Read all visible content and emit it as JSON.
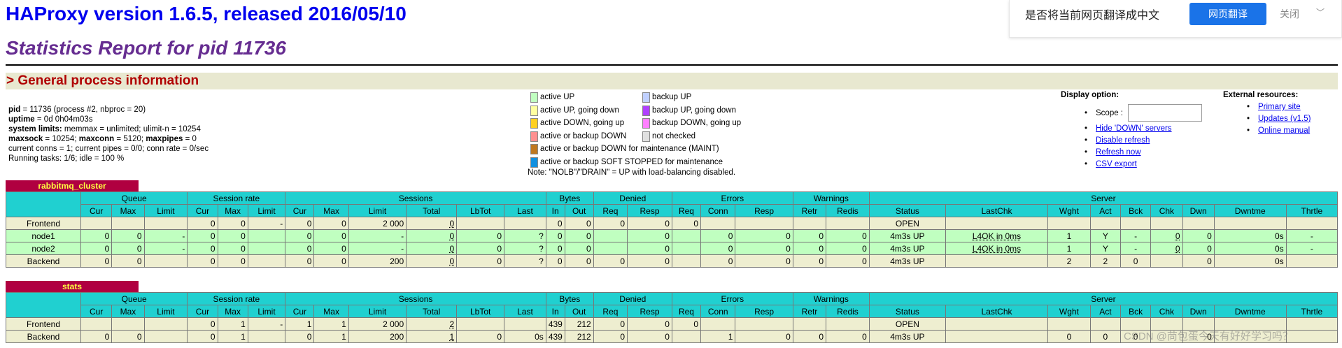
{
  "header": {
    "title": "HAProxy version 1.6.5, released 2016/05/10",
    "subtitle": "Statistics Report for pid 11736"
  },
  "translate_bar": {
    "question": "是否将当前网页翻译成中文",
    "translate_button": "网页翻译",
    "close": "关闭",
    "chevron": "﹀"
  },
  "general": {
    "heading": "> General process information",
    "lines": [
      {
        "b1": "pid",
        "t1": " = 11736 (process #2, nbproc = 20)"
      },
      {
        "b1": "uptime",
        "t1": " = 0d 0h04m03s"
      },
      {
        "b1": "system limits:",
        "t1": " memmax = unlimited; ulimit-n = 10254"
      },
      {
        "b1": "maxsock",
        "t1": " = 10254; ",
        "b2": "maxconn",
        "t2": " = 5120; ",
        "b3": "maxpipes",
        "t3": " = 0"
      },
      {
        "t1": "current conns = 1; current pipes = 0/0; conn rate = 0/sec"
      },
      {
        "t1": "Running tasks: 1/6; idle = 100 %"
      }
    ]
  },
  "legend": {
    "items": [
      {
        "label": "active UP",
        "color": "#c0ffc0"
      },
      {
        "label": "active UP, going down",
        "color": "#ffffa0"
      },
      {
        "label": "active DOWN, going up",
        "color": "#ffd020"
      },
      {
        "label": "active or backup DOWN",
        "color": "#ff9090"
      },
      {
        "label": "active or backup DOWN for maintenance (MAINT)",
        "color": "#c07820"
      },
      {
        "label": "active or backup SOFT STOPPED for maintenance",
        "color": "#1090e0"
      },
      {
        "label": "backup UP",
        "color": "#c0d0ff"
      },
      {
        "label": "backup UP, going down",
        "color": "#b040ff"
      },
      {
        "label": "backup DOWN, going up",
        "color": "#ff80ff"
      },
      {
        "label": "not checked",
        "color": "#e0e0e0"
      }
    ],
    "note": "Note: \"NOLB\"/\"DRAIN\" = UP with load-balancing disabled."
  },
  "display_option": {
    "heading": "Display option:",
    "scope_label": "Scope :",
    "links": [
      "Hide 'DOWN' servers",
      "Disable refresh",
      "Refresh now",
      "CSV export"
    ]
  },
  "external": {
    "heading": "External resources:",
    "links": [
      "Primary site",
      "Updates (v1.5)",
      "Online manual"
    ]
  },
  "columns": {
    "groups": [
      "Queue",
      "Session rate",
      "Sessions",
      "Bytes",
      "Denied",
      "Errors",
      "Warnings",
      "Server"
    ],
    "sub": [
      "Cur",
      "Max",
      "Limit",
      "Cur",
      "Max",
      "Limit",
      "Cur",
      "Max",
      "Limit",
      "Total",
      "LbTot",
      "Last",
      "In",
      "Out",
      "Req",
      "Resp",
      "Req",
      "Conn",
      "Resp",
      "Retr",
      "Redis",
      "Status",
      "LastChk",
      "Wght",
      "Act",
      "Bck",
      "Chk",
      "Dwn",
      "Dwntme",
      "Thrtle"
    ]
  },
  "proxies": [
    {
      "name": "rabbitmq_cluster",
      "rows": [
        {
          "type": "fe",
          "cells": [
            "Frontend",
            "",
            "",
            "",
            "0",
            "0",
            "-",
            "0",
            "0",
            "2 000",
            "0",
            "",
            "",
            "0",
            "0",
            "0",
            "0",
            "0",
            "",
            "",
            "",
            "",
            "OPEN",
            "",
            "",
            "",
            "",
            "",
            "",
            "",
            ""
          ]
        },
        {
          "type": "up",
          "cells": [
            "node1",
            "0",
            "0",
            "-",
            "0",
            "0",
            "",
            "0",
            "0",
            "-",
            "0",
            "0",
            "?",
            "0",
            "0",
            "",
            "0",
            "",
            "0",
            "0",
            "0",
            "0",
            "4m3s UP",
            "L4OK in 0ms",
            "1",
            "Y",
            "-",
            "0",
            "0",
            "0s",
            "-"
          ]
        },
        {
          "type": "up",
          "cells": [
            "node2",
            "0",
            "0",
            "-",
            "0",
            "0",
            "",
            "0",
            "0",
            "-",
            "0",
            "0",
            "?",
            "0",
            "0",
            "",
            "0",
            "",
            "0",
            "0",
            "0",
            "0",
            "4m3s UP",
            "L4OK in 0ms",
            "1",
            "Y",
            "-",
            "0",
            "0",
            "0s",
            "-"
          ]
        },
        {
          "type": "be",
          "cells": [
            "Backend",
            "0",
            "0",
            "",
            "0",
            "0",
            "",
            "0",
            "0",
            "200",
            "0",
            "0",
            "?",
            "0",
            "0",
            "0",
            "0",
            "",
            "0",
            "0",
            "0",
            "0",
            "4m3s UP",
            "",
            "2",
            "2",
            "0",
            "",
            "0",
            "0s",
            ""
          ]
        }
      ]
    },
    {
      "name": "stats",
      "rows": [
        {
          "type": "fe",
          "cells": [
            "Frontend",
            "",
            "",
            "",
            "0",
            "1",
            "-",
            "1",
            "1",
            "2 000",
            "2",
            "",
            "",
            "439",
            "212",
            "0",
            "0",
            "0",
            "",
            "",
            "",
            "",
            "OPEN",
            "",
            "",
            "",
            "",
            "",
            "",
            "",
            ""
          ]
        },
        {
          "type": "be",
          "cells": [
            "Backend",
            "0",
            "0",
            "",
            "0",
            "1",
            "",
            "0",
            "1",
            "200",
            "1",
            "0",
            "0s",
            "439",
            "212",
            "0",
            "0",
            "",
            "1",
            "0",
            "0",
            "0",
            "4m3s UP",
            "",
            "0",
            "0",
            "0",
            "",
            "0",
            "",
            ""
          ]
        }
      ]
    }
  ],
  "watermark": "CSDN @苘包蛋今天有好好学习吗？"
}
